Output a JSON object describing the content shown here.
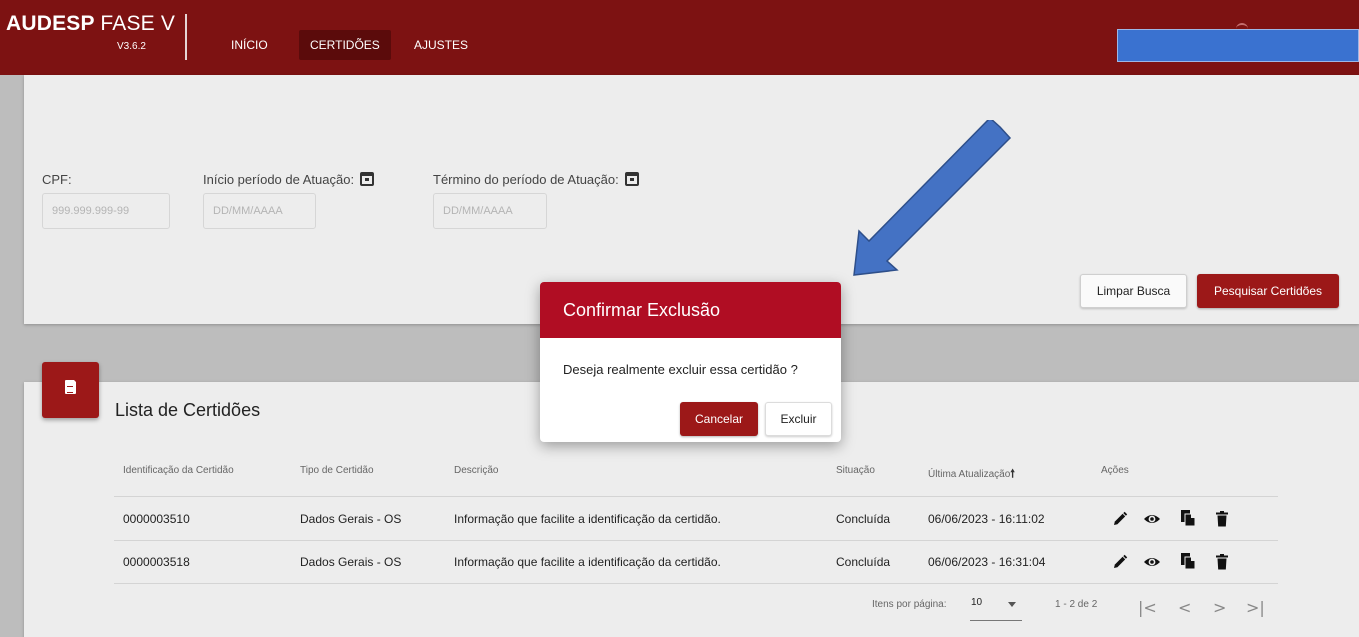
{
  "header": {
    "brand_bold": "AUDESP",
    "brand_rest": "FASE V",
    "version": "V3.6.2",
    "nav": [
      {
        "label": "INÍCIO"
      },
      {
        "label": "CERTIDÕES",
        "active": true
      },
      {
        "label": "AJUSTES"
      }
    ]
  },
  "filters": {
    "cpf_label": "CPF:",
    "cpf_placeholder": "999.999.999-99",
    "inicio_label": "Início período de Atuação:",
    "inicio_placeholder": "DD/MM/AAAA",
    "termino_label": "Término do período de Atuação:",
    "termino_placeholder": "DD/MM/AAAA",
    "clear_label": "Limpar Busca",
    "search_label": "Pesquisar Certidões"
  },
  "list": {
    "title": "Lista de Certidões",
    "columns": [
      "Identificação da Certidão",
      "Tipo de Certidão",
      "Descrição",
      "Situação",
      "Última Atualização",
      "Ações"
    ],
    "sort_indicator": "🠕",
    "rows": [
      {
        "id": "0000003510",
        "tipo": "Dados Gerais - OS",
        "descricao": "Informação que facilite a identificação da certidão.",
        "situacao": "Concluída",
        "atualizacao": "06/06/2023 - 16:11:02"
      },
      {
        "id": "0000003518",
        "tipo": "Dados Gerais - OS",
        "descricao": "Informação que facilite a identificação da certidão.",
        "situacao": "Concluída",
        "atualizacao": "06/06/2023 - 16:31:04"
      }
    ],
    "row_action_icons": [
      "edit-icon",
      "view-icon",
      "copy-icon",
      "delete-icon"
    ]
  },
  "pagination": {
    "items_label": "Itens por página:",
    "page_size": "10",
    "range": "1 - 2 de 2",
    "first": "|<",
    "prev": "<",
    "next": ">",
    "last": ">|"
  },
  "dialog": {
    "title": "Confirmar Exclusão",
    "message": "Deseja realmente excluir essa certidão ?",
    "cancel_label": "Cancelar",
    "confirm_label": "Excluir"
  },
  "colors": {
    "topbar": "#7d1212",
    "primary": "#9c1818",
    "dialog_header": "#b00d23",
    "annotation_arrow": "#4472c4"
  }
}
